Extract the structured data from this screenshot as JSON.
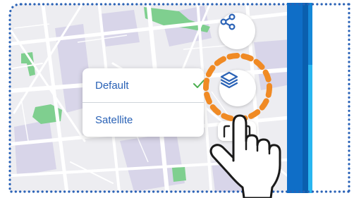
{
  "map": {
    "layer_menu": {
      "items": [
        {
          "label": "Default",
          "selected": true
        },
        {
          "label": "Satellite",
          "selected": false
        }
      ]
    },
    "buttons": {
      "share_icon": "share-icon",
      "layers_icon": "layers-icon",
      "record_icon": "record-frame-icon"
    }
  },
  "gesture": {
    "type": "tap",
    "target": "layers-button",
    "icon": "tap-hand-icon"
  },
  "colors": {
    "map_bg": "#ededf1",
    "roads": "#ffffff",
    "blocks": "#d8d5e9",
    "parks": "#7fcf8f",
    "accent": "#2a62b6",
    "dots_border": "#2a62b6",
    "tap_ring": "#f08a24",
    "check": "#4caf50",
    "side_bar": "#0f6ec7",
    "side_bar_light": "#29b6f0"
  }
}
